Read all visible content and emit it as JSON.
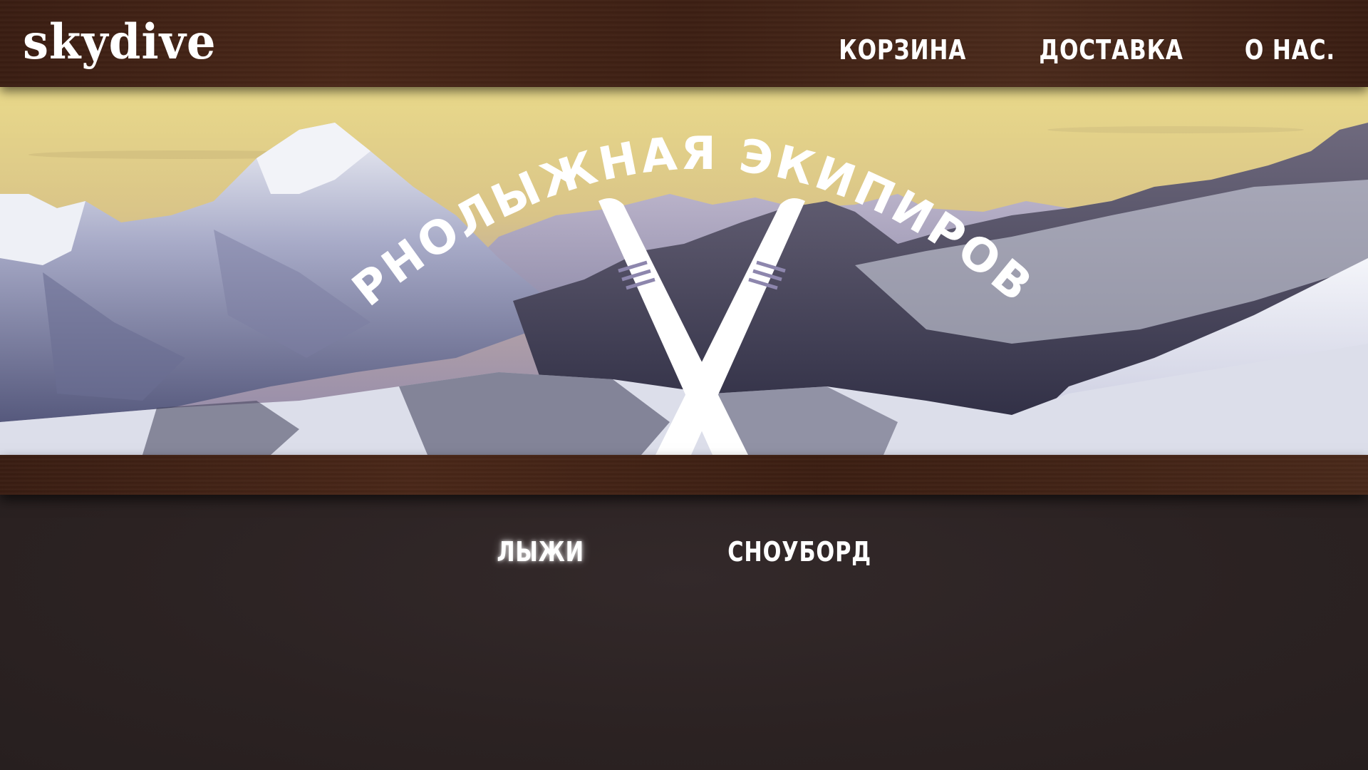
{
  "header": {
    "logo": "skydive",
    "nav": [
      {
        "label": "КОРЗИНА"
      },
      {
        "label": "ДОСТАВКА"
      },
      {
        "label": "О НАС."
      }
    ]
  },
  "hero": {
    "title": "ГОРНОЛЫЖНАЯ ЭКИПИРОВКА",
    "emblem": "crossed-skis-icon"
  },
  "categories": [
    {
      "label": "ЛЫЖИ",
      "active": true
    },
    {
      "label": "СНОУБОРД",
      "active": false
    }
  ],
  "colors": {
    "wood": "#4a2718",
    "background": "#2b2121",
    "text": "#ffffff"
  }
}
